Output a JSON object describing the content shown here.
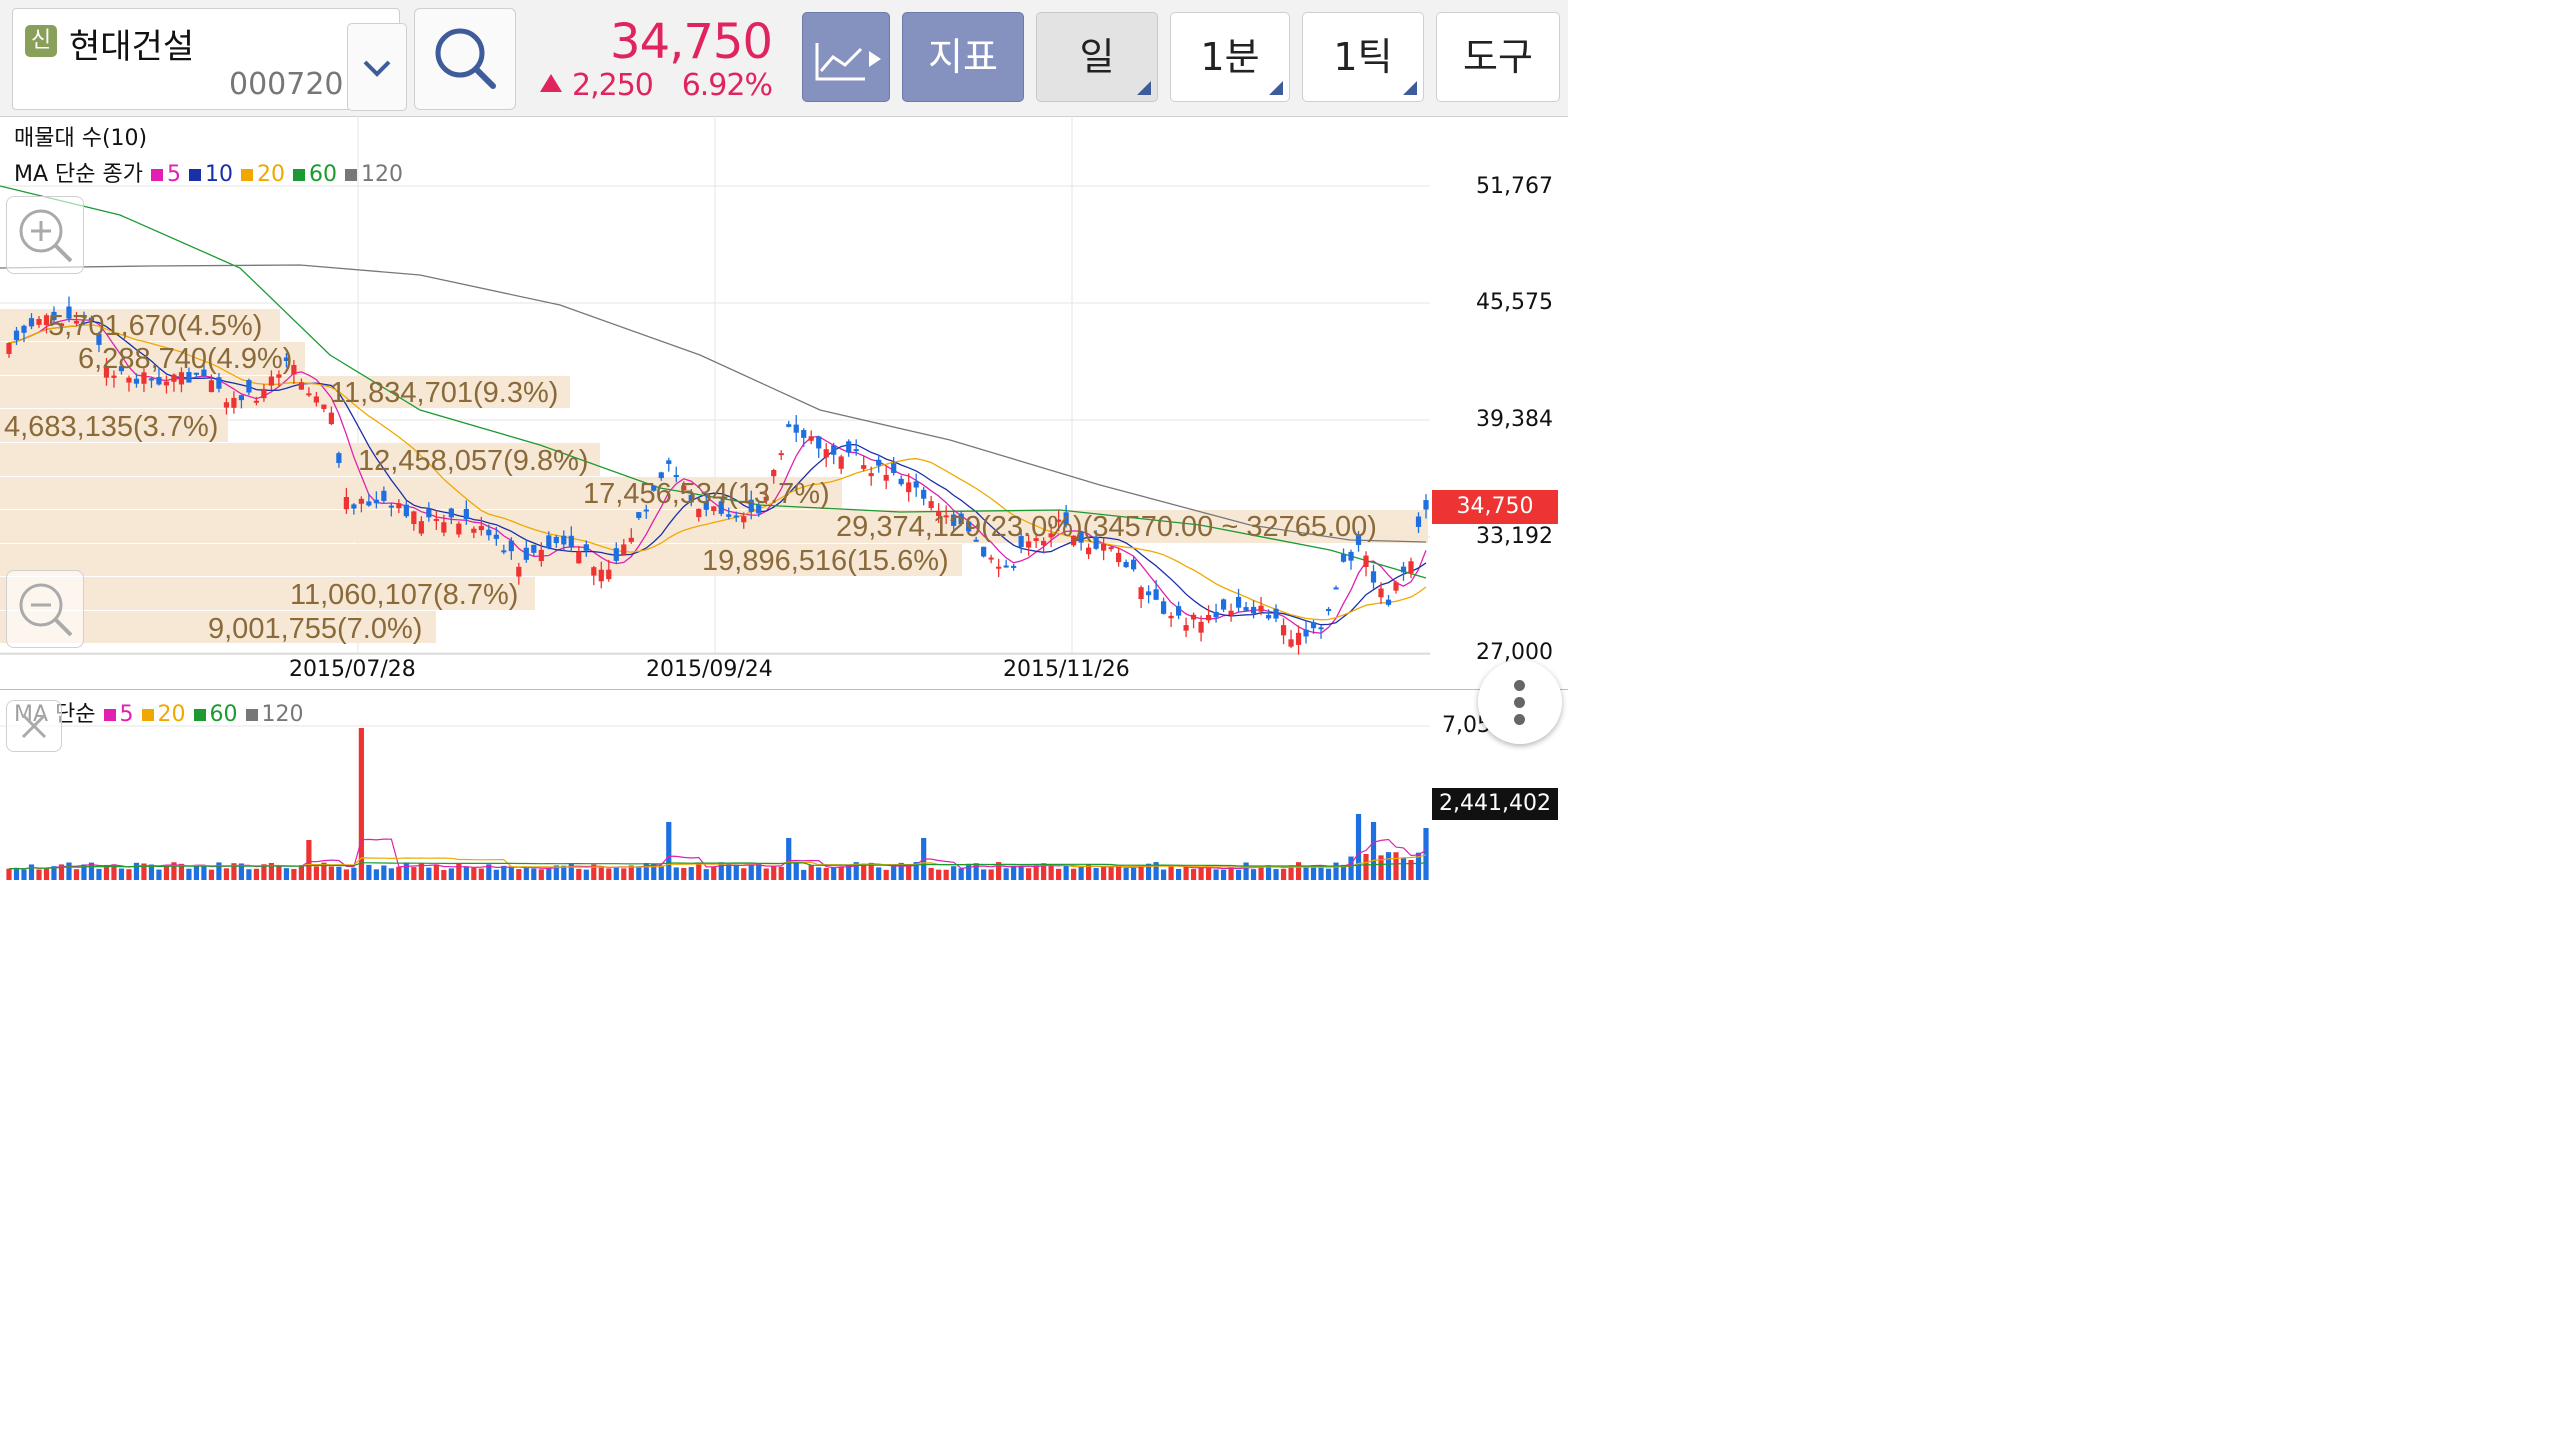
{
  "header": {
    "badge": "신",
    "stock_name": "현대건설",
    "stock_code": "000720",
    "price": "34,750",
    "change": "2,250",
    "change_pct": "6.92%",
    "tools": [
      {
        "label": "",
        "icon": "line-chart-icon"
      },
      {
        "label": "지표"
      },
      {
        "label": "일"
      },
      {
        "label": "1분"
      },
      {
        "label": "1틱"
      },
      {
        "label": "도구"
      }
    ]
  },
  "price_chart": {
    "title_vp": "매물대 수(10)",
    "ma_label": "MA 단순 종가",
    "ma_periods": [
      "5",
      "10",
      "20",
      "60",
      "120"
    ],
    "ma_colors": [
      "#e020b0",
      "#1a2fa8",
      "#f0a800",
      "#1a9a30",
      "#777777"
    ],
    "y_ticks": [
      "51,767",
      "45,575",
      "39,384",
      "33,192",
      "27,000"
    ],
    "x_ticks": [
      "2015/07/28",
      "2015/09/24",
      "2015/11/26"
    ],
    "current_price_label": "34,750",
    "volume_profile": [
      "5,701,670(4.5%)",
      "6,288,740(4.9%)",
      "11,834,701(9.3%)",
      "4,683,135(3.7%)",
      "12,458,057(9.8%)",
      "17,456,534(13.7%)",
      "29,374,129(23.0%)(34570.00 ~ 32765.00)",
      "19,896,516(15.6%)",
      "11,060,107(8.7%)",
      "9,001,755(7.0%)"
    ]
  },
  "volume_chart": {
    "ma_label": "MA 단순",
    "ma_periods": [
      "5",
      "20",
      "60",
      "120"
    ],
    "ma_colors": [
      "#e020b0",
      "#f0a800",
      "#1a9a30",
      "#777777"
    ],
    "y_top": "7,059,715",
    "current_volume": "2,441,402"
  },
  "colors": {
    "up": "#ee3333",
    "down": "#1e6fe0",
    "accent": "#e0245e",
    "profile": "#f5e3cc"
  }
}
